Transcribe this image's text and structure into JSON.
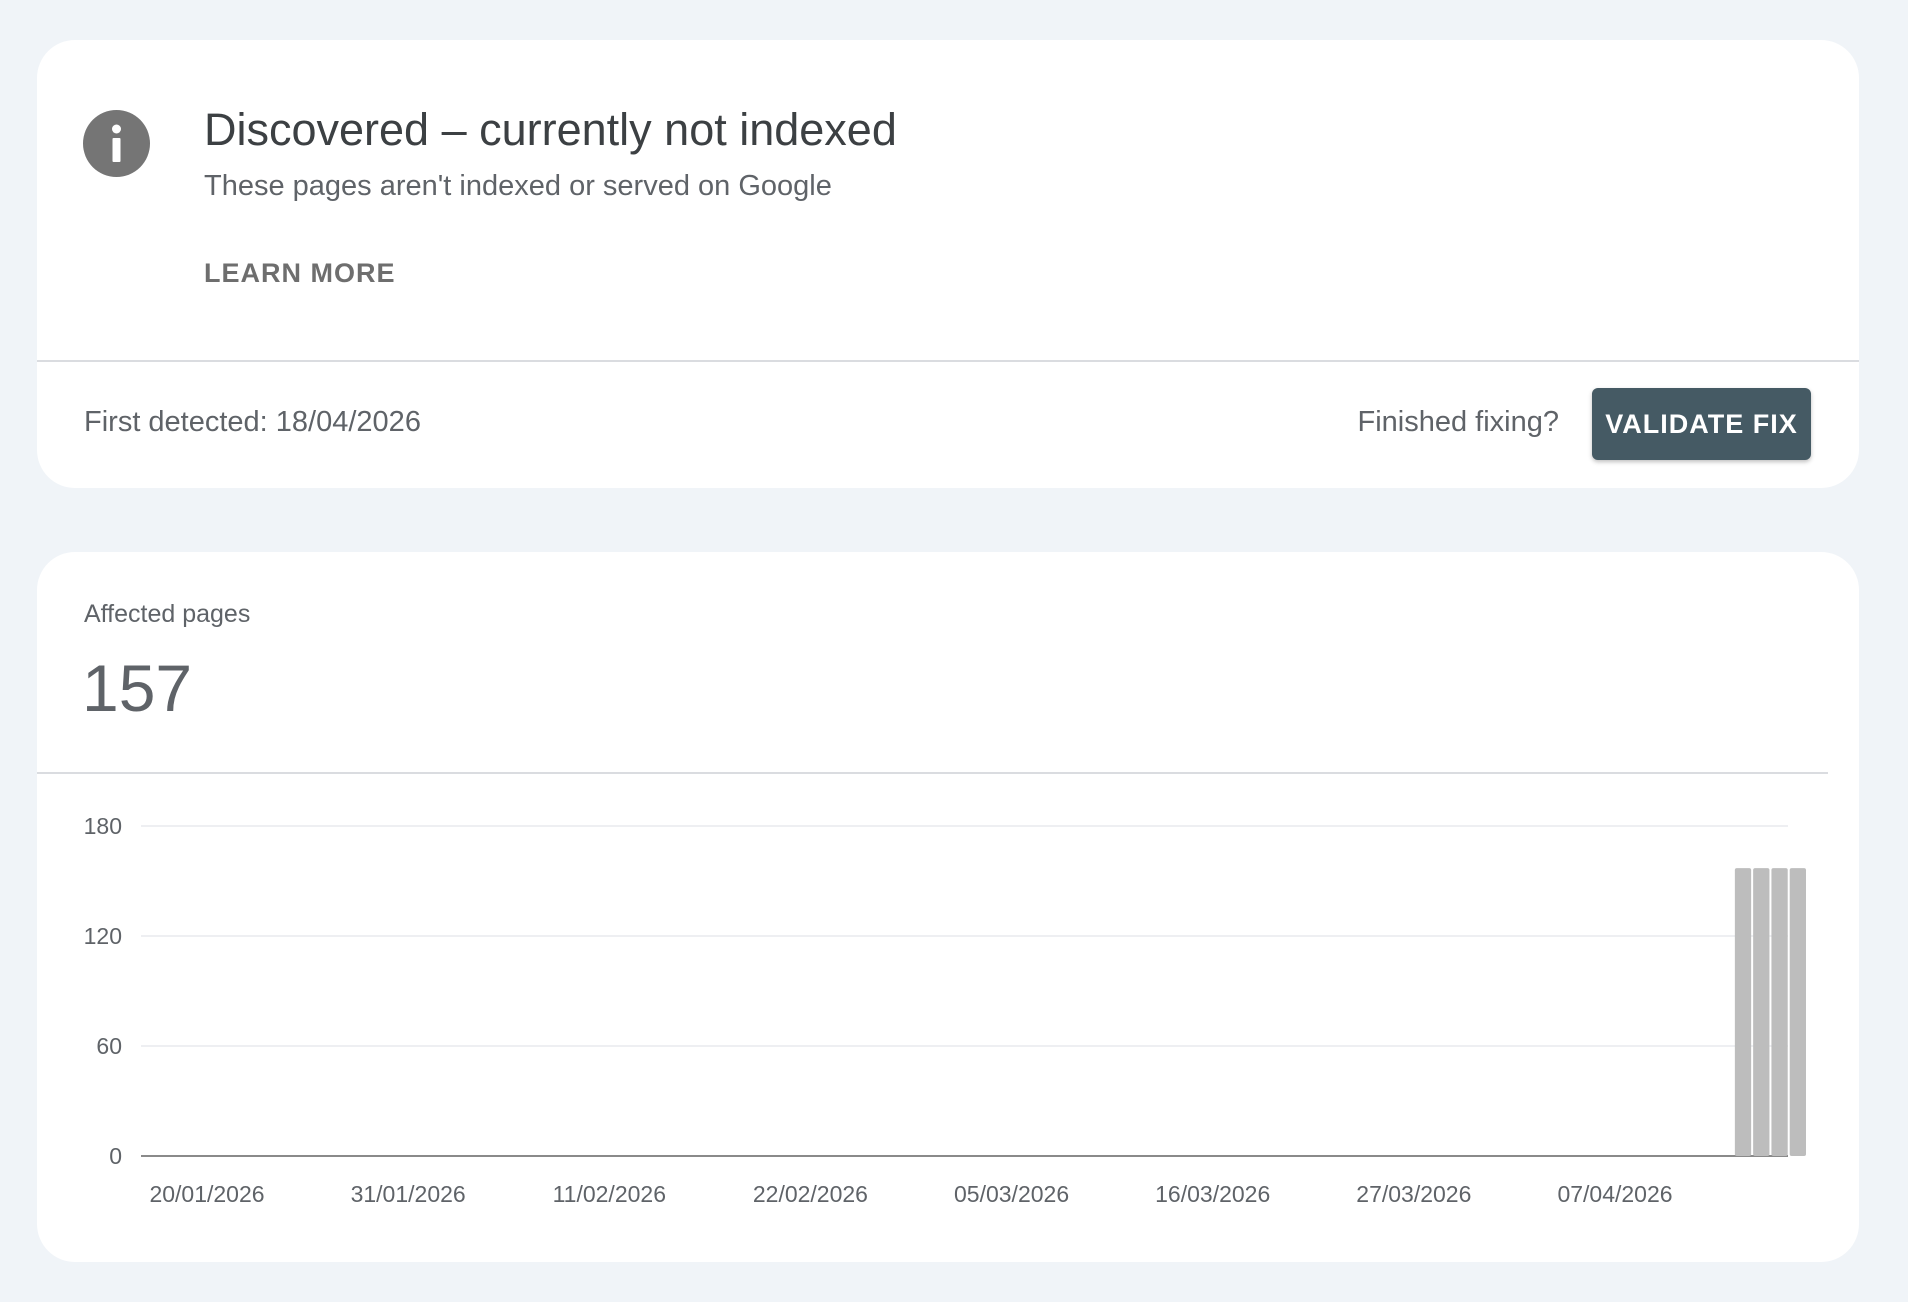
{
  "issue": {
    "title": "Discovered – currently not indexed",
    "subtitle": "These pages aren't indexed or served on Google",
    "learn_more": "LEARN MORE",
    "first_detected": "First detected: 18/04/2026",
    "finished_prompt": "Finished fixing?",
    "validate_label": "VALIDATE FIX",
    "icon": "info-icon"
  },
  "metric": {
    "label": "Affected pages",
    "value": "157"
  },
  "colors": {
    "background": "#f0f4f8",
    "button": "#455a64",
    "bar": "#bdbdbd",
    "icon": "#757575"
  },
  "chart_data": {
    "type": "bar",
    "title": "",
    "xlabel": "",
    "ylabel": "",
    "ylim": [
      0,
      180
    ],
    "yticks": [
      0,
      60,
      120,
      180
    ],
    "grid": true,
    "x_start": "20/01/2026",
    "x_end": "17/04/2026",
    "xtick_labels": [
      "20/01/2026",
      "31/01/2026",
      "11/02/2026",
      "22/02/2026",
      "05/03/2026",
      "16/03/2026",
      "27/03/2026",
      "07/04/2026"
    ],
    "bars": [
      {
        "date": "14/04/2026",
        "value": 157
      },
      {
        "date": "15/04/2026",
        "value": 157
      },
      {
        "date": "16/04/2026",
        "value": 157
      },
      {
        "date": "17/04/2026",
        "value": 157
      }
    ]
  }
}
